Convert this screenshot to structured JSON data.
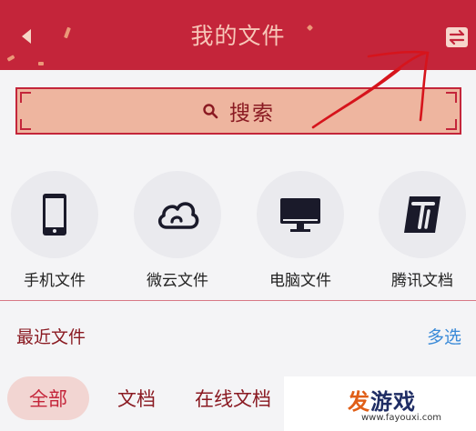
{
  "header": {
    "title": "我的文件",
    "back_icon": "back-arrow-icon",
    "switch_icon": "switch-view-icon",
    "bg_color": "#c4253a"
  },
  "search": {
    "label": "搜索",
    "icon": "search-icon"
  },
  "categories": [
    {
      "label": "手机文件",
      "icon": "phone-icon"
    },
    {
      "label": "微云文件",
      "icon": "cloud-icon"
    },
    {
      "label": "电脑文件",
      "icon": "monitor-icon"
    },
    {
      "label": "腾讯文档",
      "icon": "tencent-docs-icon"
    }
  ],
  "recent": {
    "title": "最近文件",
    "multi_select": "多选"
  },
  "tabs": [
    {
      "label": "全部",
      "active": true
    },
    {
      "label": "文档",
      "active": false
    },
    {
      "label": "在线文档",
      "active": false
    }
  ],
  "watermark": {
    "brand_hot": "发",
    "brand_rest": "游戏",
    "url": "www.fayouxi.com"
  },
  "colors": {
    "accent": "#c4253a",
    "link": "#3a8ad8"
  }
}
